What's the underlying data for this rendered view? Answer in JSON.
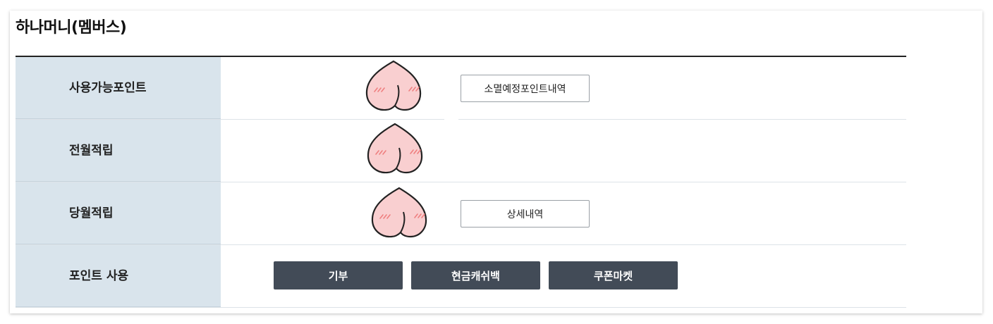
{
  "title": "하나머니(멤버스)",
  "rows": [
    {
      "label": "사용가능포인트",
      "button": "소멸예정포인트내역"
    },
    {
      "label": "전월적립"
    },
    {
      "label": "당월적립",
      "button": "상세내역"
    },
    {
      "label": "포인트 사용",
      "actions": [
        "기부",
        "현금캐쉬백",
        "쿠폰마켓"
      ]
    }
  ],
  "icons": {
    "peach": "peach-icon"
  },
  "colors": {
    "label_bg": "#d9e4ec",
    "dark_button": "#424b57",
    "peach_fill": "#f9cfd0",
    "peach_stroke": "#222222",
    "peach_hatch": "#ef7f7f"
  }
}
